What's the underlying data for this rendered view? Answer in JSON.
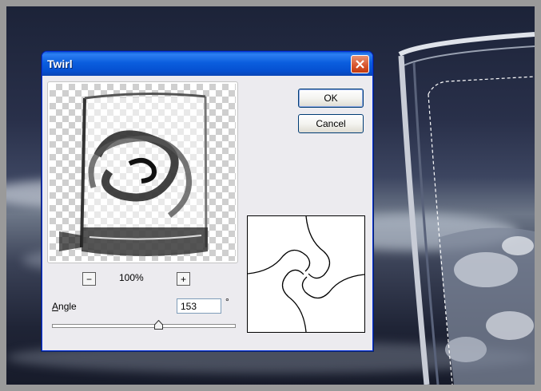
{
  "dialog": {
    "title": "Twirl",
    "ok_label": "OK",
    "cancel_label": "Cancel",
    "zoom": "100%",
    "zoom_minus": "−",
    "zoom_plus": "+",
    "angle_label": "Angle",
    "angle_value": "153",
    "angle_unit": "°",
    "angle_slider_level": 0.58
  },
  "icons": [
    "close-icon",
    "zoom-out-icon",
    "zoom-in-icon",
    "slider-thumb-icon"
  ],
  "colors": {
    "titlebar": "#0b5ede",
    "close_button": "#d8542c",
    "dialog_bg": "#ecebef"
  }
}
